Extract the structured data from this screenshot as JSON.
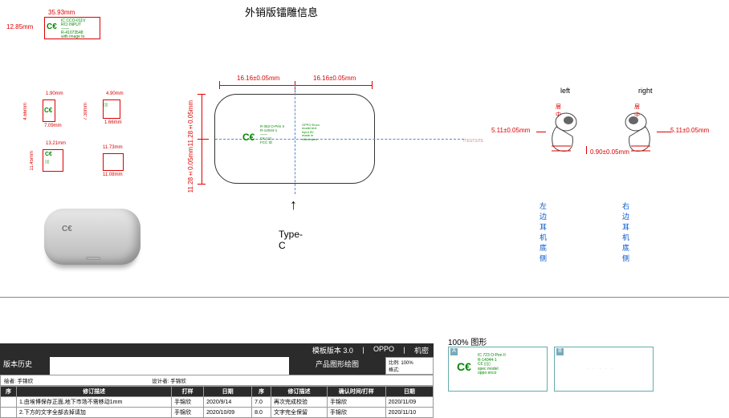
{
  "page_title": "外销版镭雕信息",
  "top_block": {
    "width_label": "35.93mm",
    "height_label": "12.85mm"
  },
  "mid_left_blocks": {
    "b1": {
      "w": "1.90mm",
      "h": "7.09mm"
    },
    "b2": {
      "w": "4.90mm",
      "h": "1.66mm",
      "side": "7.30mm"
    },
    "b3": {
      "w": "13.21mm",
      "h": "11.45mm"
    },
    "b4": {
      "w": "11.73mm",
      "h": "11.08mm"
    }
  },
  "main_case": {
    "top_dim_left": "16.16±0.05mm",
    "top_dim_right": "16.16±0.05mm",
    "side_dim_top": "11.28±0.05mm",
    "side_dim_bottom": "11.28±0.05mm",
    "port_label": "Type-C",
    "tiny_right": "/TESTSITE"
  },
  "earbuds": {
    "left_label": "left",
    "right_label": "right",
    "top_l": "居中",
    "top_r": "居中",
    "dim_l": "5.11±0.05mm",
    "dim_r": "5.11±0.05mm",
    "gap": "0.90±0.05mm",
    "caption_l": "左边耳机底侧",
    "caption_r": "右边耳机底侧"
  },
  "footer": {
    "template_ver": "模板版本 3.0",
    "brand": "OPPO",
    "conf": "机密",
    "history_title": "版本历史",
    "drawing_title": "产品图形绘图",
    "scale_label": "比例: 100%",
    "format": "格式:",
    "author_prefix": "绘者:",
    "reviser_prefix": "设计者:",
    "author": "手锦欣",
    "cols": [
      "序",
      "修订描述",
      "打样",
      "日期",
      "序",
      "修订描述",
      "确认时间/打样",
      "日期"
    ],
    "rows": [
      [
        "",
        "1.由埃博保存正面,地下市场不需移动1mm",
        "手锦欣",
        "2020/9/14",
        "7.0",
        "再次完成校验",
        "手锦欣",
        "2020/11/09"
      ],
      [
        "",
        "2.下方的文字全部去掉请加",
        "手锦欣",
        "2020/10/09",
        "8.0",
        "文字完全保留",
        "手锦欣",
        "2020/11/10"
      ]
    ]
  },
  "thumb_title": "100% 图形",
  "thumb_a": "A",
  "thumb_b": "B"
}
